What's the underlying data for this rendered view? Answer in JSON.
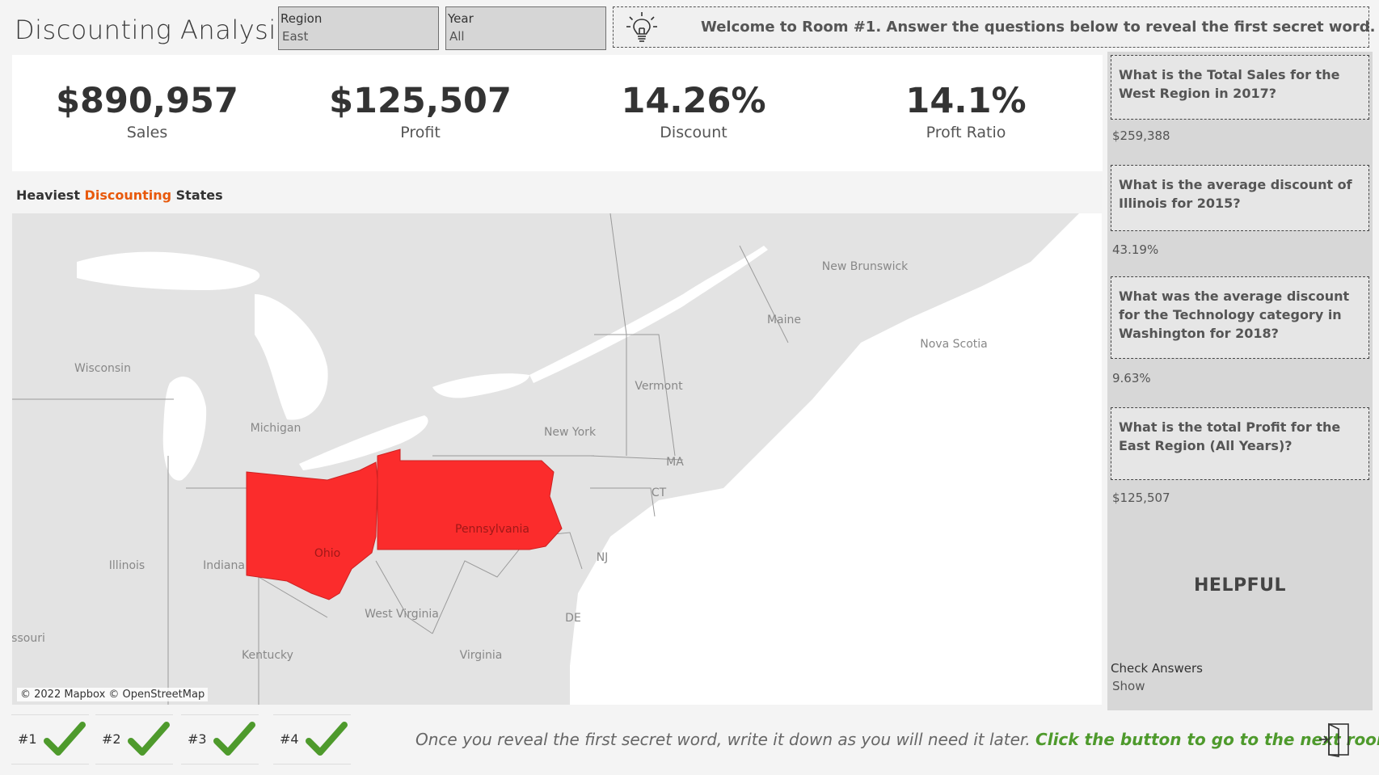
{
  "header": {
    "title": "Discounting Analysis",
    "filters": [
      {
        "label": "Region",
        "value": "East"
      },
      {
        "label": "Year",
        "value": "All"
      }
    ],
    "welcome": "Welcome to Room #1. Answer the questions below to reveal the first secret word."
  },
  "kpis": [
    {
      "value": "$890,957",
      "label": "Sales"
    },
    {
      "value": "$125,507",
      "label": "Profit"
    },
    {
      "value": "14.26%",
      "label": "Discount"
    },
    {
      "value": "14.1%",
      "label": "Proft Ratio"
    }
  ],
  "map": {
    "title_parts": [
      "Heaviest ",
      "Discounting",
      " States"
    ],
    "title_accent_color": "#e8590c",
    "highlight_color": "#fb2c2c",
    "highlighted_states": [
      "Ohio",
      "Pennsylvania"
    ],
    "place_labels": [
      "New Brunswick",
      "Maine",
      "Nova Scotia",
      "Wisconsin",
      "Michigan",
      "Vermont",
      "New York",
      "MA",
      "CT",
      "Ohio",
      "Pennsylvania",
      "NJ",
      "Illinois",
      "Indiana",
      "West Virginia",
      "Kentucky",
      "Virginia",
      "DE",
      "ssouri"
    ],
    "attribution": "© 2022 Mapbox © OpenStreetMap"
  },
  "panel": {
    "questions": [
      {
        "q": "What is the Total Sales for the West Region in 2017?",
        "a": "$259,388"
      },
      {
        "q": "What is the average discount of Illinois for 2015?",
        "a": "43.19%"
      },
      {
        "q": "What was the average discount for the Technology category in Washington for 2018?",
        "a": "9.63%"
      },
      {
        "q": "What is the total Profit for the East Region (All Years)?",
        "a": "$125,507"
      }
    ],
    "helpful": "HELPFUL",
    "check_label": "Check Answers",
    "check_value": "Show"
  },
  "progress": [
    {
      "label": "#1",
      "status": "check-icon"
    },
    {
      "label": "#2",
      "status": "check-icon"
    },
    {
      "label": "#3",
      "status": "check-icon"
    },
    {
      "label": "#4",
      "status": "check-icon"
    }
  ],
  "footer": {
    "text": "Once you reveal the first secret word, write it down as you will need it later. ",
    "link": "Click the button to go to the next room",
    "link_color": "#4e9a2c"
  }
}
